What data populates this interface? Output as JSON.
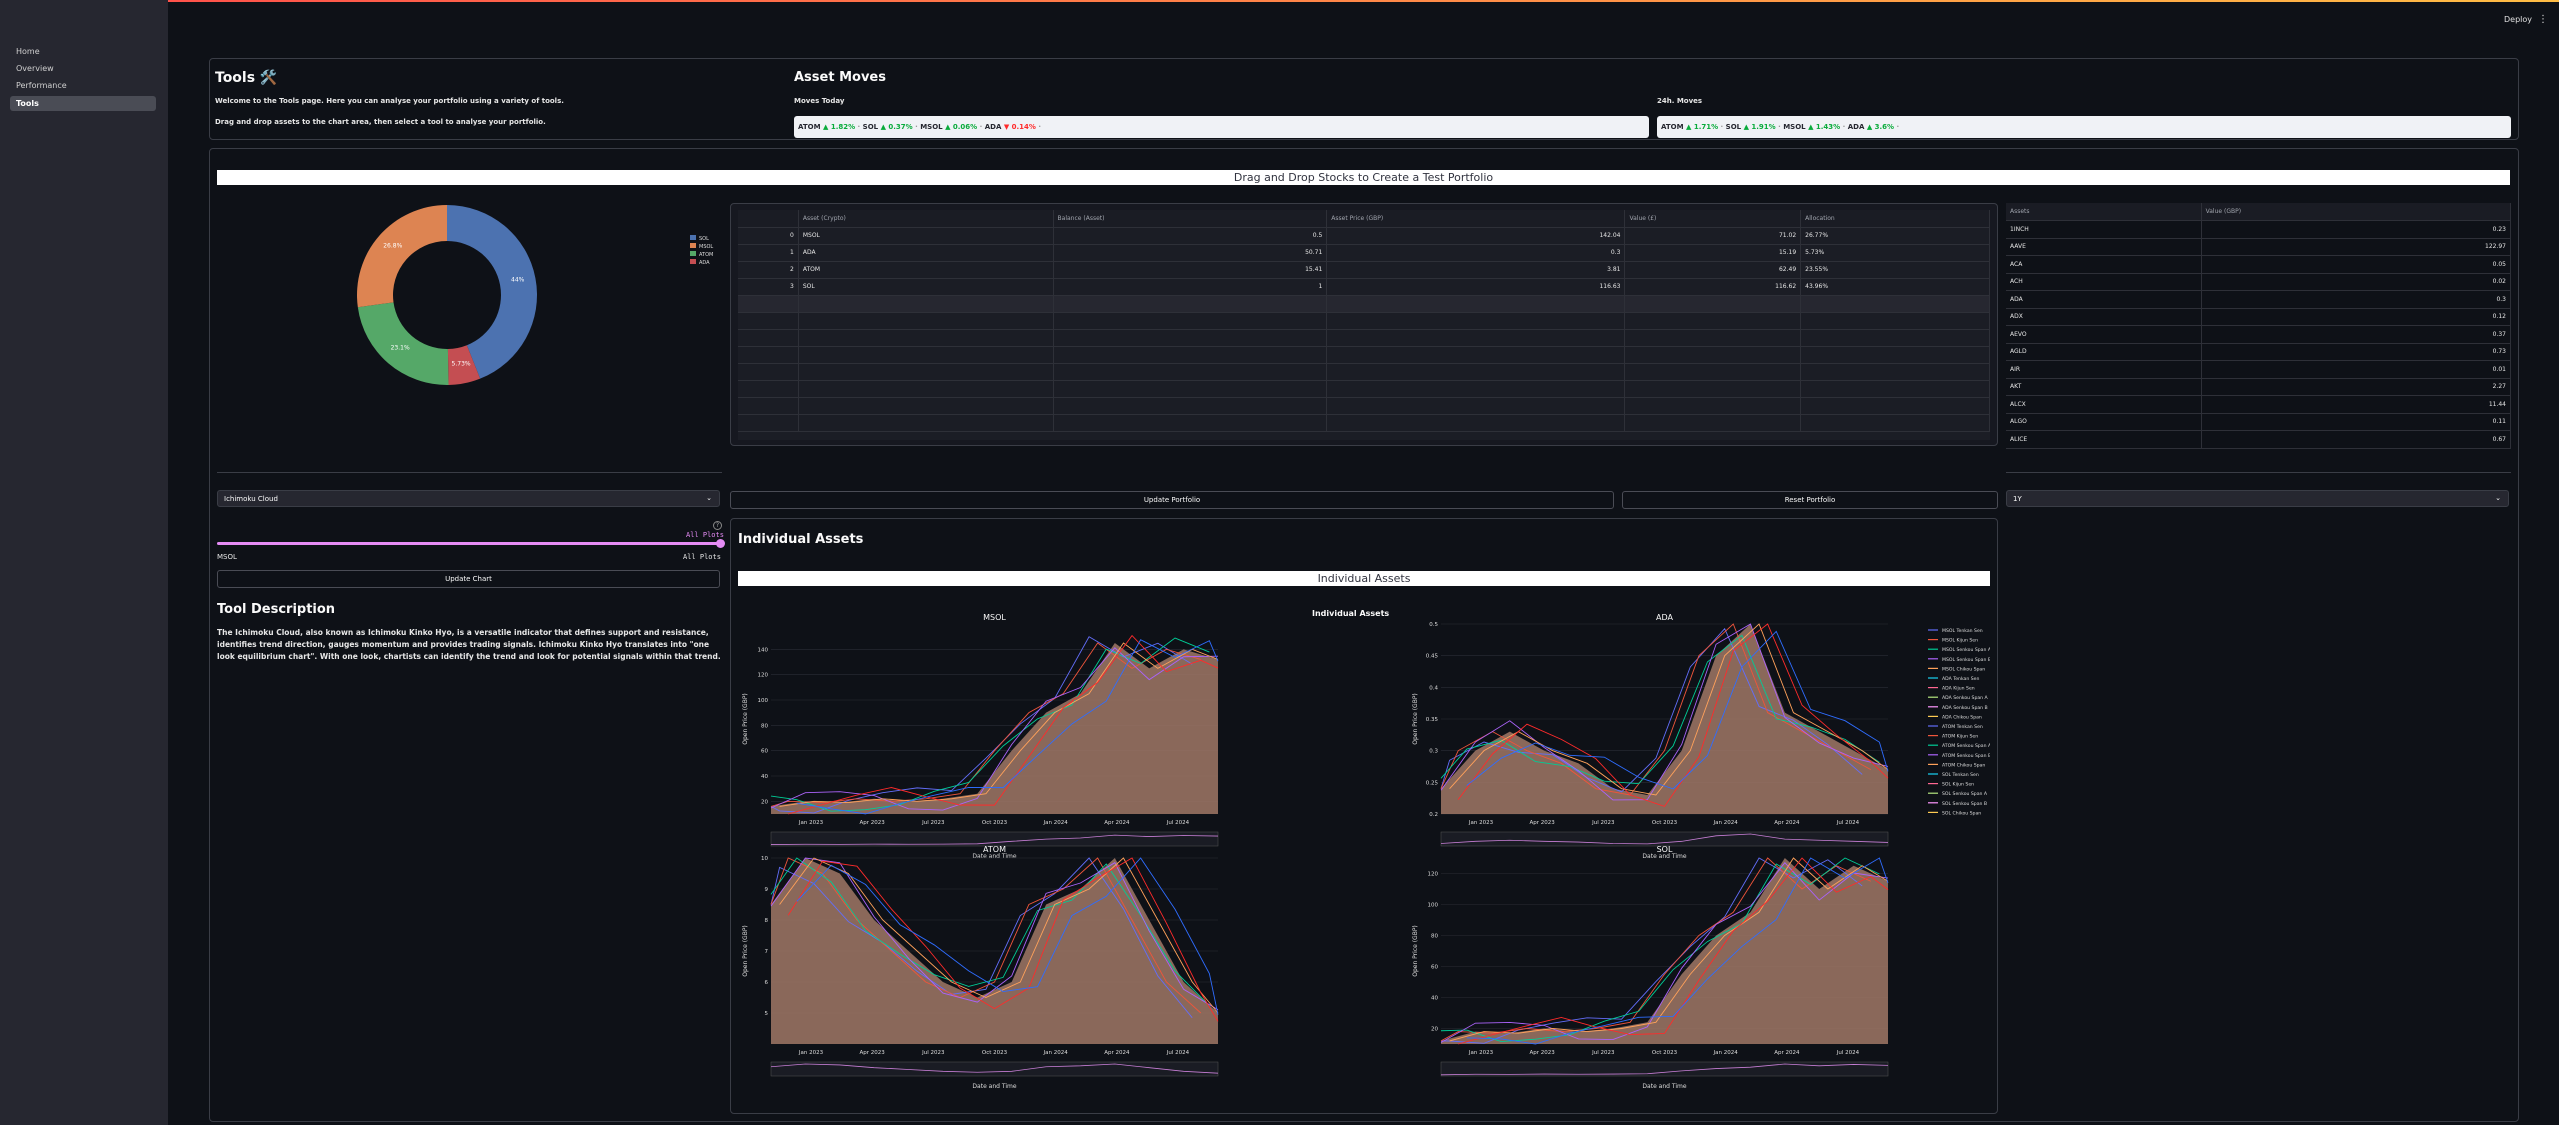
{
  "sidebar": {
    "items": [
      {
        "label": "Home"
      },
      {
        "label": "Overview"
      },
      {
        "label": "Performance"
      },
      {
        "label": "Tools"
      }
    ]
  },
  "header": {
    "deploy_label": "Deploy",
    "menu_icon": "⋮"
  },
  "tools": {
    "title": "Tools 🛠️",
    "intro": "Welcome to the Tools page. Here you can analyse your portfolio using a variety of tools.",
    "instructions": "Drag and drop assets to the chart area, then select a tool to analyse your portfolio."
  },
  "asset_moves": {
    "title": "Asset Moves",
    "today_label": "Moves Today",
    "today": [
      {
        "asset": "ATOM",
        "dir": "up",
        "change": "1.82%"
      },
      {
        "asset": "SOL",
        "dir": "up",
        "change": "0.37%"
      },
      {
        "asset": "MSOL",
        "dir": "up",
        "change": "0.06%"
      },
      {
        "asset": "ADA",
        "dir": "down",
        "change": "0.14%"
      }
    ],
    "h24_label": "24h. Moves",
    "h24": [
      {
        "asset": "ATOM",
        "dir": "up",
        "change": "1.71%"
      },
      {
        "asset": "SOL",
        "dir": "up",
        "change": "1.91%"
      },
      {
        "asset": "MSOL",
        "dir": "up",
        "change": "1.43%"
      },
      {
        "asset": "ADA",
        "dir": "up",
        "change": "3.6%"
      }
    ]
  },
  "portfolio_banner": "Drag and Drop Stocks to Create a Test Portfolio",
  "pie": {
    "legend": [
      "SOL",
      "MSOL",
      "ATOM",
      "ADA"
    ],
    "slices": [
      {
        "label": "SOL",
        "percent": 44,
        "text": "44%",
        "color": "#4c72b0"
      },
      {
        "label": "ADA",
        "percent": 5.73,
        "text": "5.73%",
        "color": "#c44e52"
      },
      {
        "label": "ATOM",
        "percent": 23.1,
        "text": "23.1%",
        "color": "#55a868"
      },
      {
        "label": "MSOL",
        "percent": 27.17,
        "text": "26.8%",
        "color": "#dd8452"
      }
    ]
  },
  "portfolio_table": {
    "columns": [
      "",
      "Asset (Crypto)",
      "Balance (Asset)",
      "Asset Price (GBP)",
      "Value (£)",
      "Allocation"
    ],
    "rows": [
      {
        "idx": "0",
        "asset": "MSOL",
        "balance": "0.5",
        "price": "142.04",
        "value": "71.02",
        "alloc": "26.77%"
      },
      {
        "idx": "1",
        "asset": "ADA",
        "balance": "50.71",
        "price": "0.3",
        "value": "15.19",
        "alloc": "5.73%"
      },
      {
        "idx": "2",
        "asset": "ATOM",
        "balance": "15.41",
        "price": "3.81",
        "value": "62.49",
        "alloc": "23.55%"
      },
      {
        "idx": "3",
        "asset": "SOL",
        "balance": "1",
        "price": "116.63",
        "value": "116.62",
        "alloc": "43.96%"
      }
    ]
  },
  "assets_list": {
    "columns": [
      "Assets",
      "Value (GBP)"
    ],
    "rows": [
      {
        "asset": "1INCH",
        "value": "0.23"
      },
      {
        "asset": "AAVE",
        "value": "122.97"
      },
      {
        "asset": "ACA",
        "value": "0.05"
      },
      {
        "asset": "ACH",
        "value": "0.02"
      },
      {
        "asset": "ADA",
        "value": "0.3"
      },
      {
        "asset": "ADX",
        "value": "0.12"
      },
      {
        "asset": "AEVO",
        "value": "0.37"
      },
      {
        "asset": "AGLD",
        "value": "0.73"
      },
      {
        "asset": "AIR",
        "value": "0.01"
      },
      {
        "asset": "AKT",
        "value": "2.27"
      },
      {
        "asset": "ALCX",
        "value": "11.44"
      },
      {
        "asset": "ALGO",
        "value": "0.11"
      },
      {
        "asset": "ALICE",
        "value": "0.67"
      }
    ]
  },
  "controls": {
    "tool_select": "Ichimoku Cloud",
    "slider_value": "All Plots",
    "slider_min": "MSOL",
    "slider_max": "All Plots",
    "update_chart": "Update Chart",
    "update_portfolio": "Update Portfolio",
    "reset_portfolio": "Reset Portfolio",
    "period_select": "1Y",
    "help_icon": "?"
  },
  "description": {
    "title": "Tool Description",
    "text": "The Ichimoku Cloud, also known as Ichimoku Kinko Hyo, is a versatile indicator that defines support and resistance, identifies trend direction, gauges momentum and provides trading signals. Ichimoku Kinko Hyo translates into \"one look equilibrium chart\". With one look, chartists can identify the trend and look for potential signals within that trend."
  },
  "individual_assets": {
    "title": "Individual Assets",
    "banner": "Individual Assets",
    "figure_title": "Individual Assets",
    "legend": [
      {
        "name": "MSOL Tenkan Sen",
        "color": "#636efa"
      },
      {
        "name": "MSOL Kijun Sen",
        "color": "#ef553b"
      },
      {
        "name": "MSOL Senkou Span A",
        "color": "#00cc96"
      },
      {
        "name": "MSOL Senkou Span B",
        "color": "#ab63fa"
      },
      {
        "name": "MSOL Chikou Span",
        "color": "#ffa15a"
      },
      {
        "name": "ADA Tenkan Sen",
        "color": "#19d3f3"
      },
      {
        "name": "ADA Kijun Sen",
        "color": "#ff6692"
      },
      {
        "name": "ADA Senkou Span A",
        "color": "#b6e880"
      },
      {
        "name": "ADA Senkou Span B",
        "color": "#ff97ff"
      },
      {
        "name": "ADA Chikou Span",
        "color": "#fecb52"
      },
      {
        "name": "ATOM Tenkan Sen",
        "color": "#636efa"
      },
      {
        "name": "ATOM Kijun Sen",
        "color": "#ef553b"
      },
      {
        "name": "ATOM Senkou Span A",
        "color": "#00cc96"
      },
      {
        "name": "ATOM Senkou Span B",
        "color": "#ab63fa"
      },
      {
        "name": "ATOM Chikou Span",
        "color": "#ffa15a"
      },
      {
        "name": "SOL Tenkan Sen",
        "color": "#19d3f3"
      },
      {
        "name": "SOL Kijun Sen",
        "color": "#ff6692"
      },
      {
        "name": "SOL Senkou Span A",
        "color": "#b6e880"
      },
      {
        "name": "SOL Senkou Span B",
        "color": "#ff97ff"
      },
      {
        "name": "SOL Chikou Span",
        "color": "#fecb52"
      }
    ],
    "xlabel": "Date and Time",
    "ylabel": "Open Price (GBP)",
    "xticks": [
      "Jan 2023",
      "Apr 2023",
      "Jul 2023",
      "Oct 2023",
      "Jan 2024",
      "Apr 2024",
      "Jul 2024"
    ]
  },
  "chart_data": [
    {
      "type": "line",
      "title": "MSOL",
      "xlabel": "Date and Time",
      "ylabel": "Open Price (GBP)",
      "ylim": [
        10,
        160
      ],
      "yticks": [
        20,
        40,
        60,
        80,
        100,
        120,
        140
      ],
      "x": [
        "Jan 2023",
        "Apr 2023",
        "Jul 2023",
        "Oct 2023",
        "Jan 2024",
        "Apr 2024",
        "Jul 2024"
      ],
      "series": [
        {
          "values": [
            16,
            20,
            19,
            22,
            20,
            22,
            26,
            60,
            90,
            105,
            145,
            125,
            140,
            132
          ]
        }
      ]
    },
    {
      "type": "line",
      "title": "ADA",
      "xlabel": "Date and Time",
      "ylabel": "Open Price (GBP)",
      "ylim": [
        0.2,
        0.5
      ],
      "yticks": [
        0.2,
        0.25,
        0.3,
        0.35,
        0.4,
        0.45,
        0.5
      ],
      "x": [
        "Jan 2023",
        "Apr 2023",
        "Jul 2023",
        "Oct 2023",
        "Jan 2024",
        "Apr 2024",
        "Jul 2024"
      ],
      "series": [
        {
          "values": [
            0.24,
            0.3,
            0.33,
            0.3,
            0.28,
            0.24,
            0.23,
            0.3,
            0.45,
            0.5,
            0.36,
            0.33,
            0.3,
            0.27
          ]
        }
      ]
    },
    {
      "type": "line",
      "title": "ATOM",
      "xlabel": "Date and Time",
      "ylabel": "Open Price (GBP)",
      "ylim": [
        4,
        10
      ],
      "yticks": [
        5,
        6,
        7,
        8,
        9,
        10
      ],
      "x": [
        "Jan 2023",
        "Apr 2023",
        "Jul 2023",
        "Oct 2023",
        "Jan 2024",
        "Apr 2024",
        "Jul 2024"
      ],
      "series": [
        {
          "values": [
            8.5,
            10,
            9.5,
            8,
            7,
            6,
            5.5,
            6,
            8.5,
            9,
            10,
            8,
            6,
            5
          ]
        }
      ]
    },
    {
      "type": "line",
      "title": "SOL",
      "xlabel": "Date and Time",
      "ylabel": "Open Price (GBP)",
      "ylim": [
        10,
        130
      ],
      "yticks": [
        20,
        40,
        60,
        80,
        100,
        120
      ],
      "x": [
        "Jan 2023",
        "Apr 2023",
        "Jul 2023",
        "Oct 2023",
        "Jan 2024",
        "Apr 2024",
        "Jul 2024"
      ],
      "series": [
        {
          "values": [
            12,
            18,
            17,
            20,
            18,
            20,
            24,
            55,
            80,
            95,
            130,
            110,
            125,
            115
          ]
        }
      ]
    }
  ]
}
